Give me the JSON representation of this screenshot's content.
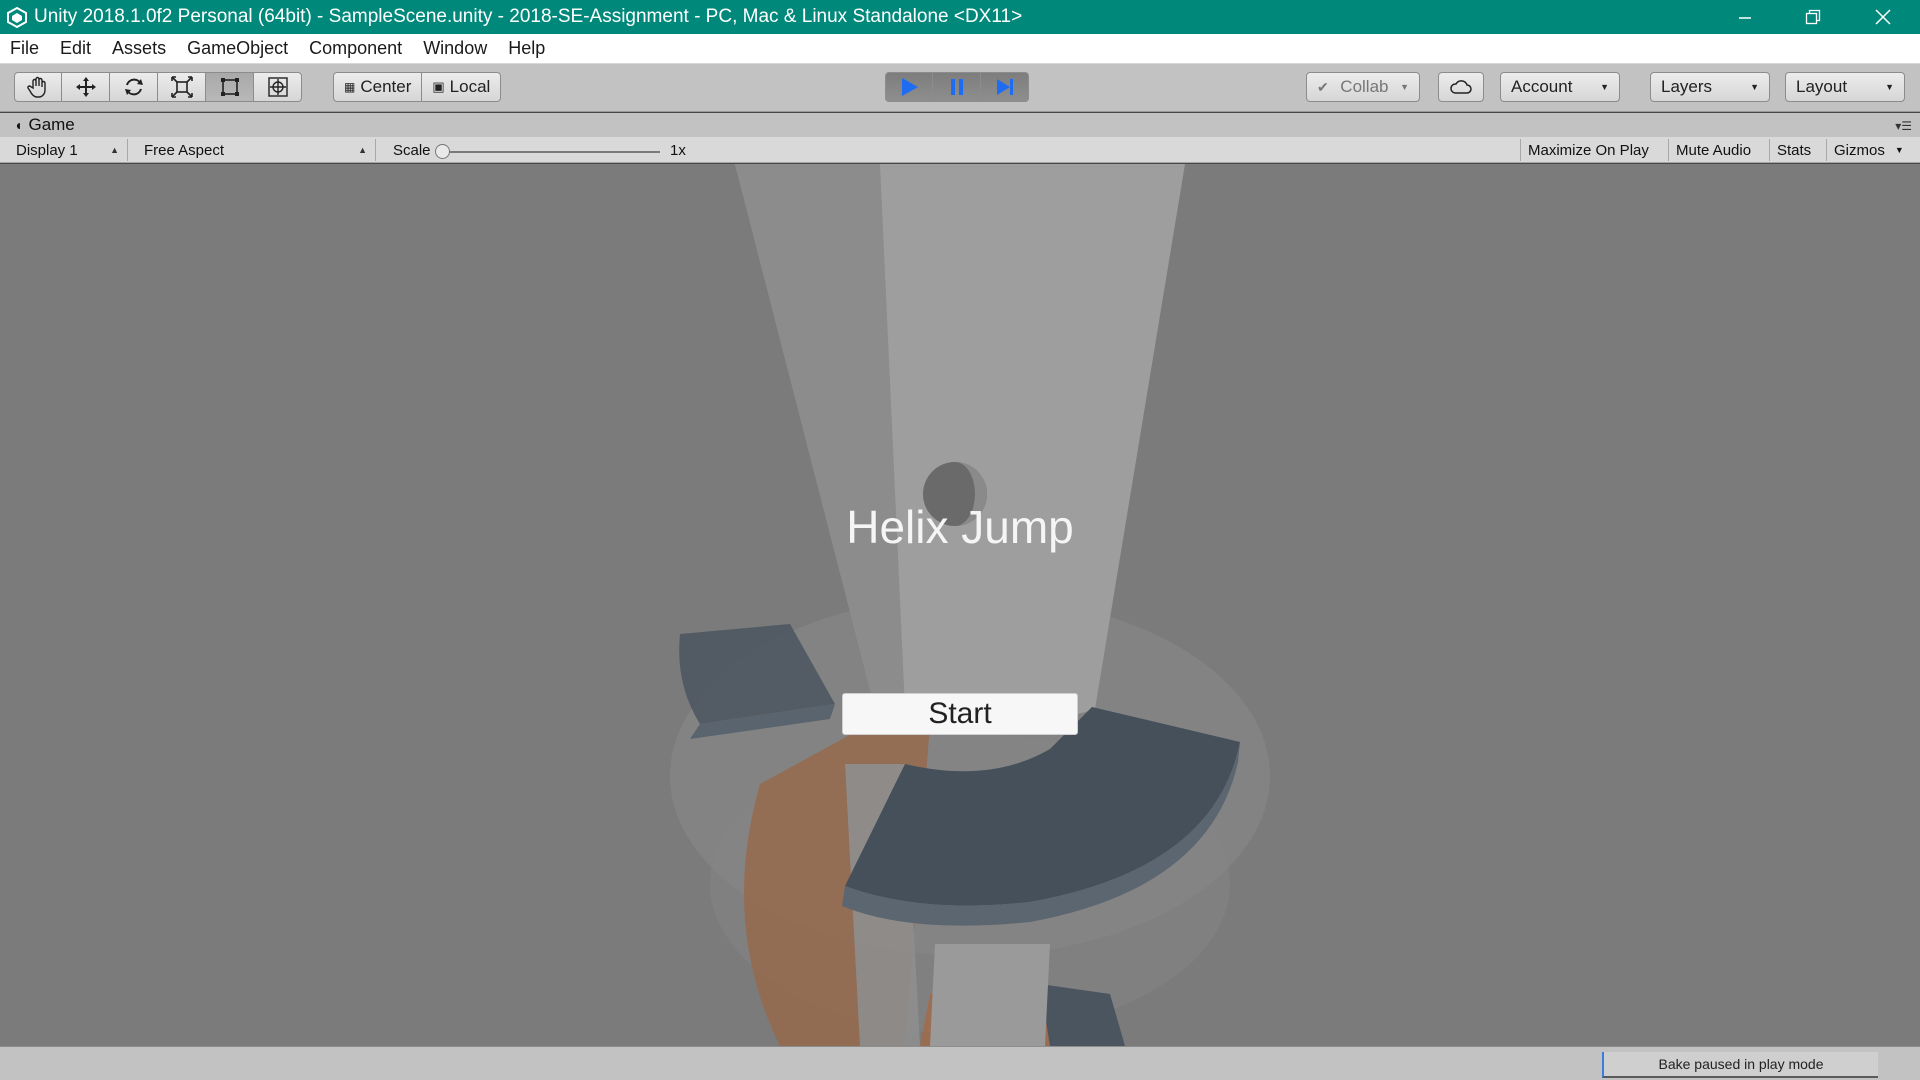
{
  "window": {
    "title": "Unity 2018.1.0f2 Personal (64bit) - SampleScene.unity - 2018-SE-Assignment - PC, Mac & Linux Standalone <DX11>",
    "app_icon": "unity-logo-icon",
    "controls": [
      "minimize-icon",
      "restore-icon",
      "close-icon"
    ]
  },
  "menu": {
    "items": [
      "File",
      "Edit",
      "Assets",
      "GameObject",
      "Component",
      "Window",
      "Help"
    ]
  },
  "toolbar": {
    "tools": [
      "hand-tool-icon",
      "move-tool-icon",
      "rotate-tool-icon",
      "scale-tool-icon",
      "rect-tool-icon",
      "transform-tool-icon"
    ],
    "active_tool": "rect-tool-icon",
    "pivot_label": "Center",
    "space_label": "Local",
    "play_controls": [
      "play-icon",
      "pause-icon",
      "step-icon"
    ],
    "playing": true,
    "collab_label": "Collab",
    "account_label": "Account",
    "layers_label": "Layers",
    "layout_label": "Layout"
  },
  "game_tab": {
    "label": "Game"
  },
  "game_toolbar": {
    "display": "Display 1",
    "aspect": "Free Aspect",
    "scale_label": "Scale",
    "scale_value": "1x",
    "maximize_on_play": "Maximize On Play",
    "mute_audio": "Mute Audio",
    "stats": "Stats",
    "gizmos": "Gizmos"
  },
  "game_view": {
    "title": "Helix Jump",
    "start_label": "Start"
  },
  "status": {
    "bake": "Bake paused in play mode"
  },
  "colors": {
    "titlebar": "#00897b",
    "play_blue": "#1e6cf2",
    "viewport_bg": "#7b7b7b",
    "platform_dark": "#46505a",
    "platform_orange": "#9a6646"
  }
}
